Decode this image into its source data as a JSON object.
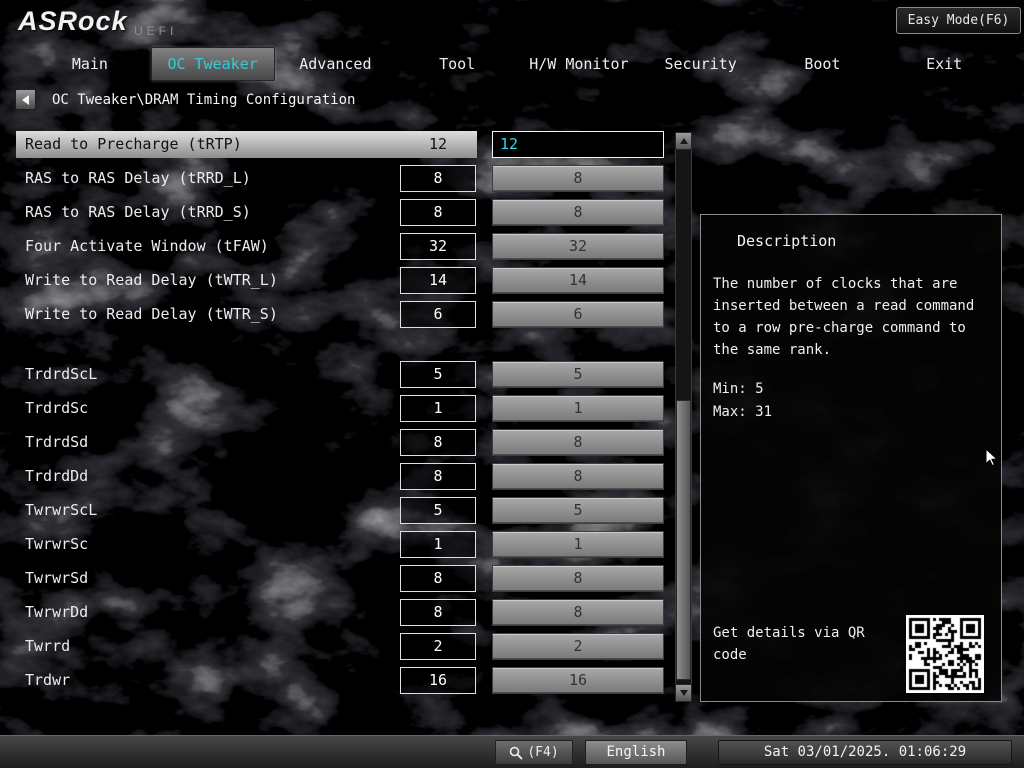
{
  "header": {
    "logo": "ASRock",
    "logo_sub": "UEFI",
    "easy_mode": "Easy Mode(F6)"
  },
  "tabs": [
    {
      "label": "Main",
      "active": false
    },
    {
      "label": "OC Tweaker",
      "active": true
    },
    {
      "label": "Advanced",
      "active": false
    },
    {
      "label": "Tool",
      "active": false
    },
    {
      "label": "H/W Monitor",
      "active": false
    },
    {
      "label": "Security",
      "active": false
    },
    {
      "label": "Boot",
      "active": false
    },
    {
      "label": "Exit",
      "active": false
    }
  ],
  "breadcrumb": {
    "text": "OC Tweaker\\DRAM Timing Configuration"
  },
  "settings": [
    {
      "label": "Read to Precharge (tRTP)",
      "value": "12",
      "input": "12",
      "selected": true
    },
    {
      "label": "RAS to RAS Delay (tRRD_L)",
      "value": "8",
      "input": "8"
    },
    {
      "label": "RAS to RAS Delay (tRRD_S)",
      "value": "8",
      "input": "8"
    },
    {
      "label": "Four Activate Window (tFAW)",
      "value": "32",
      "input": "32"
    },
    {
      "label": "Write to Read Delay (tWTR_L)",
      "value": "14",
      "input": "14"
    },
    {
      "label": "Write to Read Delay (tWTR_S)",
      "value": "6",
      "input": "6"
    },
    {
      "label": "TrdrdScL",
      "value": "5",
      "input": "5",
      "gap_before": true
    },
    {
      "label": "TrdrdSc",
      "value": "1",
      "input": "1"
    },
    {
      "label": "TrdrdSd",
      "value": "8",
      "input": "8"
    },
    {
      "label": "TrdrdDd",
      "value": "8",
      "input": "8"
    },
    {
      "label": "TwrwrScL",
      "value": "5",
      "input": "5"
    },
    {
      "label": "TwrwrSc",
      "value": "1",
      "input": "1"
    },
    {
      "label": "TwrwrSd",
      "value": "8",
      "input": "8"
    },
    {
      "label": "TwrwrDd",
      "value": "8",
      "input": "8"
    },
    {
      "label": "Twrrd",
      "value": "2",
      "input": "2"
    },
    {
      "label": "Trdwr",
      "value": "16",
      "input": "16"
    }
  ],
  "description": {
    "title": "Description",
    "body": "The number of clocks that are\ninserted between a read command\nto a row pre-charge command to\nthe same rank.",
    "min": "Min: 5",
    "max": "Max: 31",
    "qr_label": "Get details via QR code"
  },
  "footer": {
    "search_key": "(F4)",
    "language": "English",
    "datetime": "Sat 03/01/2025. 01:06:29"
  },
  "colors": {
    "accent": "#33ccd6",
    "input_active_text": "#2ed8e6",
    "selected_row_top": "#dedede",
    "selected_row_bottom": "#8e8e8e"
  }
}
